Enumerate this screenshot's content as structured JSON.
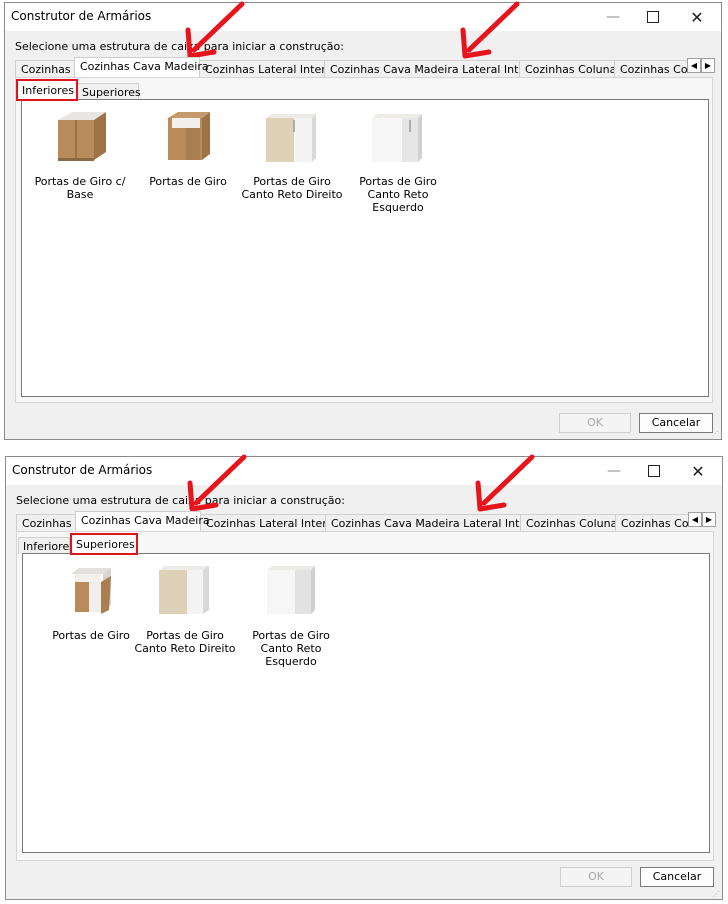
{
  "colors": {
    "highlight": "#e0141c",
    "arrow": "#e8141c"
  },
  "windows": [
    {
      "title": "Construtor de Armários",
      "controls": {
        "minimize": "—",
        "close": "✕"
      },
      "prompt": "Selecione uma estrutura de caixa para iniciar a construção:",
      "tabs": [
        "Cozinhas",
        "Cozinhas Cava Madeira",
        "Cozinhas Lateral Interna",
        "Cozinhas Cava Madeira Lateral Interna",
        "Cozinhas Colunas",
        "Cozinhas Colunas Cava"
      ],
      "active_tab": "Cozinhas Cava Madeira",
      "subtabs": [
        "Inferiores",
        "Superiores"
      ],
      "active_subtab": "Inferiores",
      "items": [
        {
          "label": "Portas de Giro c/ Base",
          "icon": "cabinet-two-doors-base-icon"
        },
        {
          "label": "Portas de Giro",
          "icon": "cabinet-two-doors-icon"
        },
        {
          "label": "Portas de Giro Canto Reto Direito",
          "icon": "corner-cabinet-right-icon"
        },
        {
          "label": "Portas de Giro Canto Reto Esquerdo",
          "icon": "corner-cabinet-left-icon"
        }
      ],
      "buttons": {
        "ok": "OK",
        "cancel": "Cancelar"
      },
      "scroll": {
        "left": "◀",
        "right": "▶"
      }
    },
    {
      "title": "Construtor de Armários",
      "controls": {
        "minimize": "—",
        "close": "✕"
      },
      "prompt": "Selecione uma estrutura de caixa para iniciar a construção:",
      "tabs": [
        "Cozinhas",
        "Cozinhas Cava Madeira",
        "Cozinhas Lateral Interna",
        "Cozinhas Cava Madeira Lateral Interna",
        "Cozinhas Colunas",
        "Cozinhas Colunas Cava"
      ],
      "active_tab": "Cozinhas Cava Madeira",
      "subtabs": [
        "Inferiores",
        "Superiores"
      ],
      "active_subtab": "Superiores",
      "items": [
        {
          "label": "Portas de Giro",
          "icon": "wall-cabinet-open-icon"
        },
        {
          "label": "Portas de Giro Canto Reto Direito",
          "icon": "wall-corner-cabinet-right-icon"
        },
        {
          "label": "Portas de Giro Canto Reto Esquerdo",
          "icon": "wall-corner-cabinet-left-icon"
        }
      ],
      "buttons": {
        "ok": "OK",
        "cancel": "Cancelar"
      },
      "scroll": {
        "left": "◀",
        "right": "▶"
      }
    }
  ]
}
